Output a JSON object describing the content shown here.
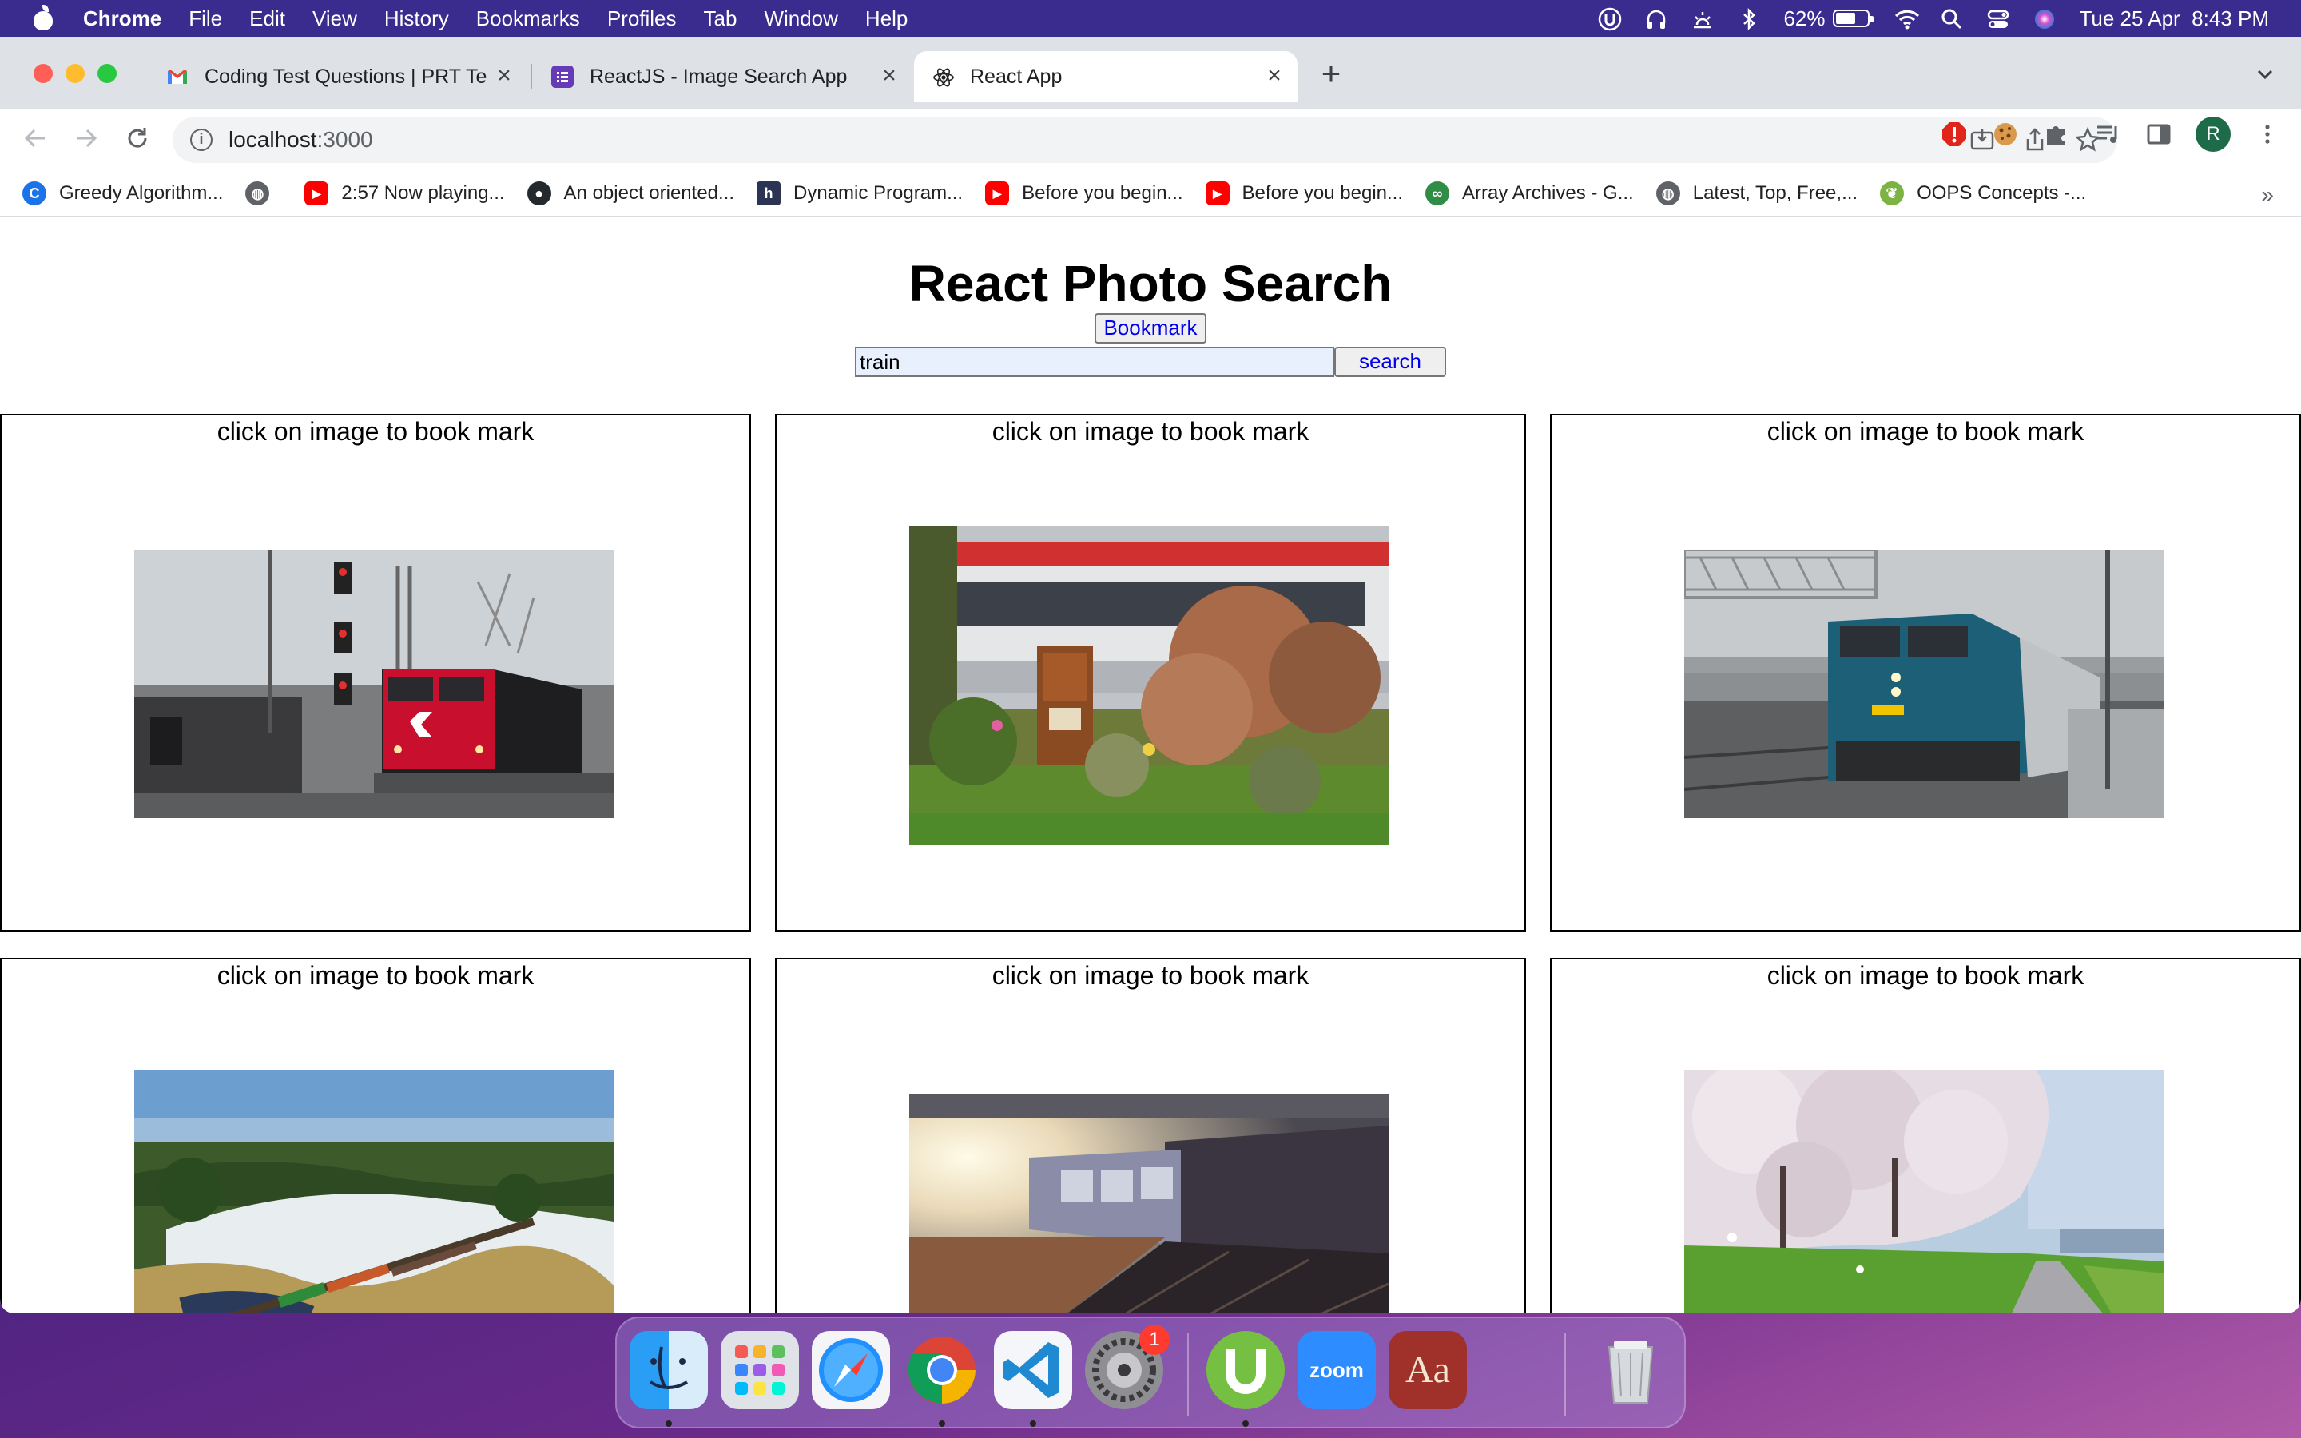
{
  "menubar": {
    "app": "Chrome",
    "items": [
      "File",
      "Edit",
      "View",
      "History",
      "Bookmarks",
      "Profiles",
      "Tab",
      "Window",
      "Help"
    ],
    "battery": "62%",
    "battery_level": 0.62,
    "datetime": "Tue 25 Apr  8:43 PM"
  },
  "tabs": [
    {
      "title": "Coding Test Questions | PRT Te",
      "favicon": "gmail-icon"
    },
    {
      "title": "ReactJS - Image Search App",
      "favicon": "forms-icon"
    },
    {
      "title": "React App",
      "favicon": "react-icon"
    }
  ],
  "address": {
    "host": "localhost",
    "port": ":3000"
  },
  "bookmarks": [
    {
      "label": "Greedy Algorithm...",
      "icon": "c-icon",
      "color": "#1a73e8"
    },
    {
      "label": "",
      "icon": "globe-icon",
      "color": "#5f6368"
    },
    {
      "label": "2:57 Now playing...",
      "icon": "youtube-icon",
      "color": "#ff0000"
    },
    {
      "label": "An object oriented...",
      "icon": "github-icon",
      "color": "#24292e"
    },
    {
      "label": "Dynamic Program...",
      "icon": "hackerrank-icon",
      "color": "#2c3454"
    },
    {
      "label": "Before you begin...",
      "icon": "youtube-icon",
      "color": "#ff0000"
    },
    {
      "label": "Before you begin...",
      "icon": "youtube-icon",
      "color": "#ff0000"
    },
    {
      "label": "Array Archives - G...",
      "icon": "gfg-icon",
      "color": "#2f8d46"
    },
    {
      "label": "Latest, Top, Free,...",
      "icon": "globe-icon",
      "color": "#5f6368"
    },
    {
      "label": "OOPS Concepts -...",
      "icon": "leaf-icon",
      "color": "#7cb342"
    }
  ],
  "page": {
    "title": "React Photo Search",
    "bookmark_label": "Bookmark",
    "search_value": "train",
    "search_label": "search",
    "cards": [
      {
        "caption": "click on image to book mark",
        "photo": "cn-locomotive-photo"
      },
      {
        "caption": "click on image to book mark",
        "photo": "garden-train-photo"
      },
      {
        "caption": "click on image to book mark",
        "photo": "via-locomotive-photo"
      },
      {
        "caption": "click on image to book mark",
        "photo": "aerial-bridge-train-photo"
      },
      {
        "caption": "click on image to book mark",
        "photo": "sunlit-platform-photo"
      },
      {
        "caption": "click on image to book mark",
        "photo": "cherry-blossom-path-photo"
      }
    ]
  },
  "dock": {
    "apps": [
      "finder",
      "launchpad",
      "safari",
      "chrome",
      "vscode",
      "system-settings",
      "utorrent",
      "zoom",
      "dictionary",
      "trash"
    ],
    "settings_badge": "1",
    "zoom_label": "zoom",
    "dictionary_label": "Aa"
  }
}
